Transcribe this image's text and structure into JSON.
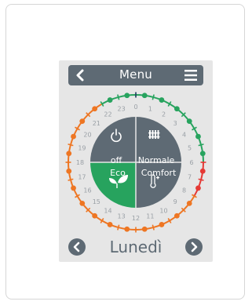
{
  "header": {
    "title": "Menu",
    "back_icon": "chevron-left-icon",
    "menu_icon": "hamburger-menu-icon"
  },
  "modes": {
    "off": {
      "label": "off",
      "icon": "power-icon"
    },
    "normale": {
      "label": "Normale",
      "icon": "radiator-icon"
    },
    "eco": {
      "label": "Eco",
      "icon": "leaf-icon"
    },
    "comfort": {
      "label": "Comfort",
      "icon": "thermometer-plus-icon"
    }
  },
  "hours": [
    "0",
    "1",
    "2",
    "3",
    "4",
    "5",
    "6",
    "7",
    "8",
    "9",
    "10",
    "11",
    "12",
    "13",
    "14",
    "15",
    "16",
    "17",
    "18",
    "19",
    "20",
    "21",
    "22",
    "23"
  ],
  "schedule": [
    "green",
    "green",
    "green",
    "green",
    "green",
    "green",
    "red",
    "red",
    "orange",
    "orange",
    "orange",
    "orange",
    "orange",
    "orange",
    "orange",
    "orange",
    "orange",
    "orange",
    "orange",
    "orange",
    "orange",
    "orange",
    "green",
    "green"
  ],
  "colors": {
    "green": "#27a35e",
    "orange": "#ee7623",
    "red": "#e53935",
    "navy": "#1f3a5f",
    "quadrant_gray": "#5e6a74",
    "eco_green": "#27a35e"
  },
  "day_nav": {
    "day": "Lunedì",
    "prev_icon": "chevron-left-circle-icon",
    "next_icon": "chevron-right-circle-icon"
  }
}
